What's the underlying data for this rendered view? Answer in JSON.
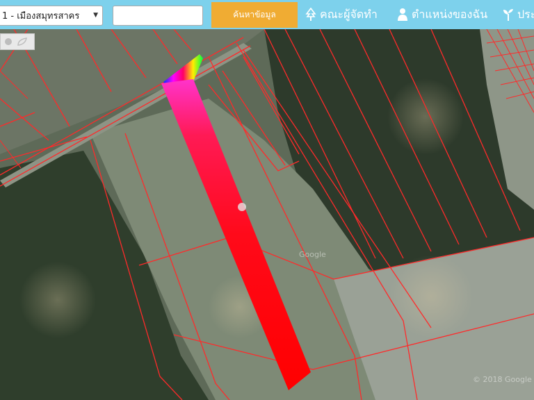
{
  "header": {
    "district_select": {
      "value": "1 - เมืองสมุทรสาคร"
    },
    "search": {
      "value": "",
      "placeholder": ""
    },
    "search_button_label": "ค้นหาข้อมูล",
    "nav": [
      {
        "label": "คณะผู้จัดทำ",
        "icon": "tree-icon"
      },
      {
        "label": "ตำแหน่งของฉัน",
        "icon": "person-icon"
      },
      {
        "label": "ประ",
        "icon": "sprout-icon"
      }
    ]
  },
  "map": {
    "tools": [
      {
        "icon": "circle-tool-icon"
      },
      {
        "icon": "leaf-tool-icon"
      }
    ],
    "watermarks": [
      "Google",
      "© 2018 Google"
    ],
    "colors": {
      "parcel_boundary": "#ff2a2a",
      "header_bar": "#7dd1ec",
      "search_button": "#f0ac33"
    }
  }
}
